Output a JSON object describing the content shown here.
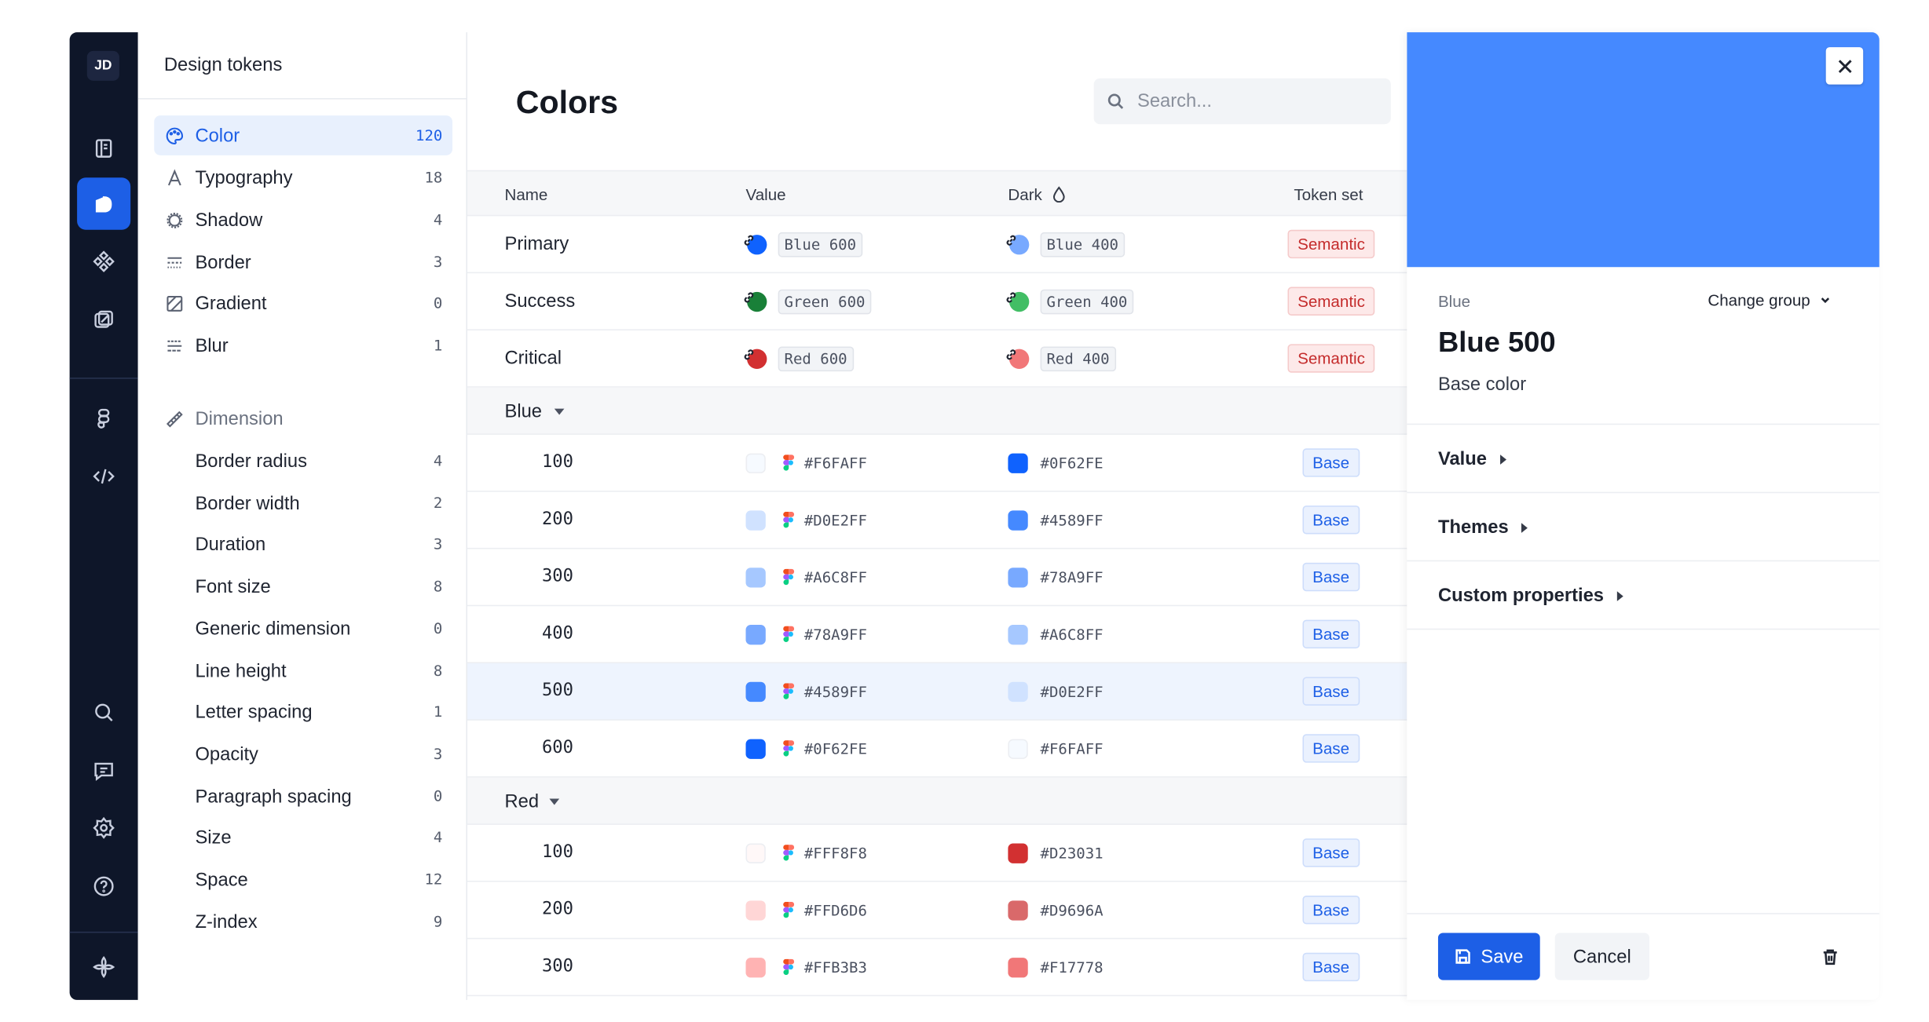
{
  "app": {
    "user_initials": "JD"
  },
  "rail": {
    "items": [
      "book-icon",
      "tokens-icon",
      "components-icon",
      "styles-icon",
      "figma-icon",
      "code-icon",
      "search-icon",
      "comments-icon",
      "settings-icon",
      "help-icon",
      "logo-icon"
    ],
    "active": "tokens-icon"
  },
  "sidebar": {
    "title": "Design tokens",
    "items": [
      {
        "label": "Color",
        "count": "120",
        "icon": "palette-icon",
        "active": true
      },
      {
        "label": "Typography",
        "count": "18",
        "icon": "typography-icon"
      },
      {
        "label": "Shadow",
        "count": "4",
        "icon": "shadow-icon"
      },
      {
        "label": "Border",
        "count": "3",
        "icon": "border-icon"
      },
      {
        "label": "Gradient",
        "count": "0",
        "icon": "gradient-icon"
      },
      {
        "label": "Blur",
        "count": "1",
        "icon": "blur-icon"
      }
    ],
    "dimension": {
      "label": "Dimension",
      "icon": "ruler-icon",
      "items": [
        {
          "label": "Border radius",
          "count": "4"
        },
        {
          "label": "Border width",
          "count": "2"
        },
        {
          "label": "Duration",
          "count": "3"
        },
        {
          "label": "Font size",
          "count": "8"
        },
        {
          "label": "Generic dimension",
          "count": "0"
        },
        {
          "label": "Line height",
          "count": "8"
        },
        {
          "label": "Letter spacing",
          "count": "1"
        },
        {
          "label": "Opacity",
          "count": "3"
        },
        {
          "label": "Paragraph spacing",
          "count": "0"
        },
        {
          "label": "Size",
          "count": "4"
        },
        {
          "label": "Space",
          "count": "12"
        },
        {
          "label": "Z-index",
          "count": "9"
        }
      ]
    }
  },
  "main": {
    "title": "Colors",
    "search_placeholder": "Search...",
    "columns": {
      "name": "Name",
      "value": "Value",
      "dark": "Dark",
      "token_set": "Token set"
    },
    "semantic_rows": [
      {
        "name": "Primary",
        "value": "Blue 600",
        "value_color": "#0F62FE",
        "dark": "Blue 400",
        "dark_color": "#78A9FF",
        "set": "Semantic"
      },
      {
        "name": "Success",
        "value": "Green 600",
        "value_color": "#198038",
        "dark": "Green 400",
        "dark_color": "#42BE65",
        "set": "Semantic"
      },
      {
        "name": "Critical",
        "value": "Red 600",
        "value_color": "#D23031",
        "dark": "Red 400",
        "dark_color": "#F17778",
        "set": "Semantic"
      }
    ],
    "groups": [
      {
        "name": "Blue",
        "rows": [
          {
            "name": "100",
            "value": "#F6FAFF",
            "dark": "#0F62FE",
            "set": "Base"
          },
          {
            "name": "200",
            "value": "#D0E2FF",
            "dark": "#4589FF",
            "set": "Base"
          },
          {
            "name": "300",
            "value": "#A6C8FF",
            "dark": "#78A9FF",
            "set": "Base"
          },
          {
            "name": "400",
            "value": "#78A9FF",
            "dark": "#A6C8FF",
            "set": "Base"
          },
          {
            "name": "500",
            "value": "#4589FF",
            "dark": "#D0E2FF",
            "set": "Base",
            "selected": true
          },
          {
            "name": "600",
            "value": "#0F62FE",
            "dark": "#F6FAFF",
            "set": "Base"
          }
        ]
      },
      {
        "name": "Red",
        "rows": [
          {
            "name": "100",
            "value": "#FFF8F8",
            "dark": "#D23031",
            "set": "Base"
          },
          {
            "name": "200",
            "value": "#FFD6D6",
            "dark": "#D9696A",
            "set": "Base"
          },
          {
            "name": "300",
            "value": "#FFB3B3",
            "dark": "#F17778",
            "set": "Base"
          }
        ]
      }
    ]
  },
  "panel": {
    "hero_color": "#4589FF",
    "group": "Blue",
    "change_group": "Change group",
    "token_name": "Blue 500",
    "description": "Base color",
    "sections": [
      "Value",
      "Themes",
      "Custom properties"
    ],
    "save": "Save",
    "cancel": "Cancel"
  },
  "colors": {
    "accent": "#1D5FE6",
    "rail": "#0E1629",
    "semantic_text": "#C42B2B"
  }
}
